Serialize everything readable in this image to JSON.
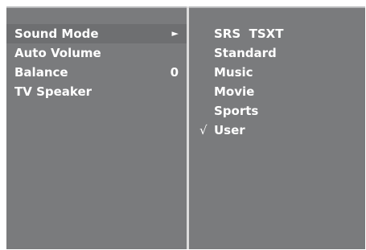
{
  "left_menu": {
    "items": [
      {
        "label": "Sound Mode",
        "indicator": "►",
        "selected": true
      },
      {
        "label": "Auto Volume"
      },
      {
        "label": "Balance",
        "value": "0"
      },
      {
        "label": "TV Speaker"
      }
    ]
  },
  "right_menu": {
    "options": [
      {
        "label": "SRS  TSXT"
      },
      {
        "label": "Standard"
      },
      {
        "label": "Music"
      },
      {
        "label": "Movie"
      },
      {
        "label": "Sports"
      },
      {
        "label": "User",
        "check": "√"
      }
    ]
  }
}
